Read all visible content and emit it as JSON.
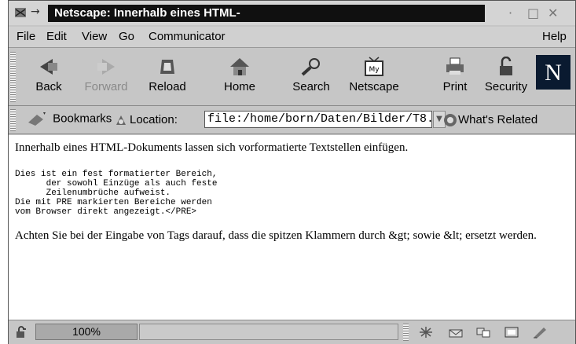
{
  "window": {
    "title": "Netscape: Innerhalb eines HTML-",
    "pin_glyph": "→",
    "minimize_glyph": "·",
    "maximize_glyph": "□",
    "close_glyph": "✕"
  },
  "menu": {
    "file": "File",
    "edit": "Edit",
    "view": "View",
    "go": "Go",
    "communicator": "Communicator",
    "help": "Help"
  },
  "toolbar": {
    "back": "Back",
    "forward": "Forward",
    "reload": "Reload",
    "home": "Home",
    "search": "Search",
    "netscape": "Netscape",
    "print": "Print",
    "security": "Security",
    "logo_letter": "N",
    "forward_disabled": true
  },
  "locationbar": {
    "bookmarks": "Bookmarks",
    "location_label": "Location:",
    "url": "file:/home/born/Daten/Bilder/T8.",
    "whats_related": "What's Related"
  },
  "content": {
    "intro": "Innerhalb eines HTML-Dokuments lassen sich vorformatierte Textstellen einfügen.",
    "pre": "Dies ist ein fest formatierter Bereich,\n      der sowohl Einzüge als auch feste\n      Zeilenumbrüche aufweist.\nDie mit PRE markierten Bereiche werden\nvom Browser direkt angezeigt.</PRE>",
    "note": "Achten Sie bei der Eingabe von Tags darauf, dass die spitzen Klammern durch &gt; sowie &lt; ersetzt werden."
  },
  "statusbar": {
    "progress": "100%"
  },
  "colors": {
    "chrome": "#c6c6c6",
    "title_bg": "#101010",
    "progress_fill": "#a9a9a9"
  }
}
